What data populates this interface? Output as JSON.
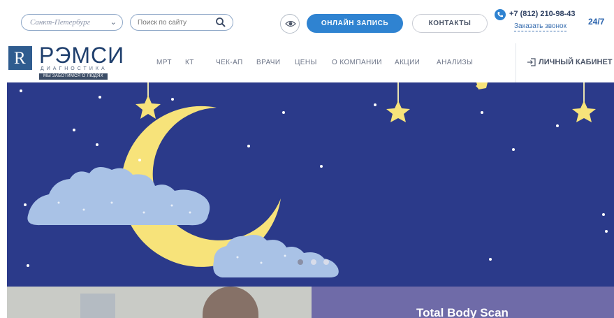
{
  "header": {
    "city": "Санкт-Петербург",
    "search_placeholder": "Поиск по сайту",
    "book_button": "ОНЛАЙН ЗАПИСЬ",
    "contacts_button": "КОНТАКТЫ",
    "phone": "+7 (812) 210-98-43",
    "callback": "Заказать звонок",
    "hours": "24/7"
  },
  "logo": {
    "letter": "R",
    "name": "РЭМСИ",
    "subtitle": "ДИАГНОСТИКА",
    "tagline": "МЫ ЗАБОТИМСЯ О ЛЮДЯХ"
  },
  "nav": {
    "items": [
      "МРТ",
      "КТ",
      "ЧЕК-АП",
      "ВРАЧИ",
      "ЦЕНЫ",
      "О КОМПАНИИ",
      "АКЦИИ",
      "АНАЛИЗЫ"
    ],
    "cabinet": "ЛИЧНЫЙ КАБИНЕТ"
  },
  "hero": {
    "slides_total": 3,
    "active_slide": 1
  },
  "cards": {
    "right_title": "Total Body Scan"
  },
  "colors": {
    "primary": "#2f83d1",
    "hero_bg": "#2b3a8a",
    "moon": "#f7e37a",
    "cloud": "#a9c2e6",
    "star": "#f7e37a"
  }
}
